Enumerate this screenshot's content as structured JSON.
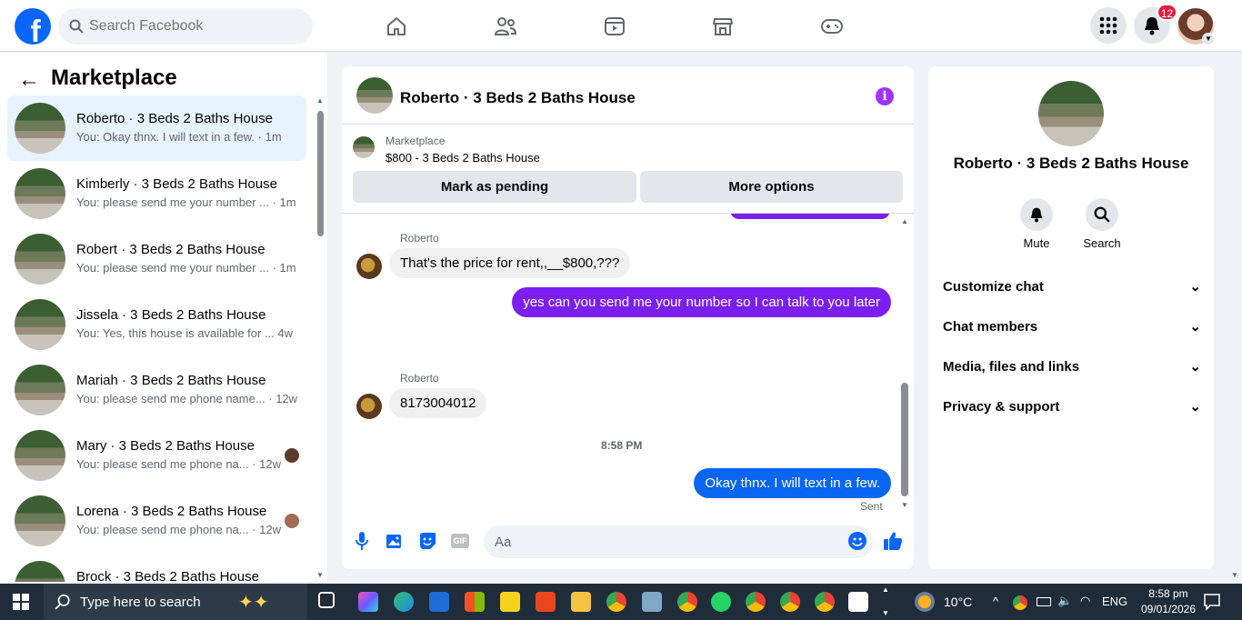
{
  "topbar": {
    "logo_letter": "f",
    "search_placeholder": "Search Facebook",
    "notification_count": "12",
    "nav_icons": [
      "home-icon",
      "friends-icon",
      "watch-icon",
      "marketplace-icon",
      "gaming-icon"
    ]
  },
  "sidebar": {
    "title": "Marketplace",
    "conversations": [
      {
        "name": "Roberto · 3 Beds 2 Baths House",
        "preview": "You: Okay thnx. I will text in a few. · 1m",
        "active": true
      },
      {
        "name": "Kimberly · 3 Beds 2 Baths House",
        "preview": "You: please send me your number ... · 1m"
      },
      {
        "name": "Robert · 3 Beds 2 Baths House",
        "preview": "You: please send me your number ... · 1m"
      },
      {
        "name": "Jissela · 3 Beds 2 Baths House",
        "preview": "You: Yes, this house is available for ...  4w"
      },
      {
        "name": "Mariah · 3 Beds 2 Baths House",
        "preview": "You: please send me phone name... · 12w"
      },
      {
        "name": "Mary · 3 Beds 2 Baths House",
        "preview": "You: please send me phone na... · 12w"
      },
      {
        "name": "Lorena · 3 Beds 2 Baths House",
        "preview": "You: please send me phone na... · 12w"
      },
      {
        "name": "Brock · 3 Beds 2 Baths House",
        "preview": ""
      }
    ]
  },
  "chat": {
    "title": "Roberto · 3 Beds 2 Baths House",
    "listing_source": "Marketplace",
    "listing_price": "$800 - 3 Beds 2 Baths House",
    "mark_pending": "Mark as pending",
    "more_options": "More options",
    "messages": {
      "sender1": "Roberto",
      "m1": "That's the price for rent,,__$800,???",
      "m2": "yes  can you send me your number so I can talk to you later",
      "sender2": "Roberto",
      "m3": "8173004012",
      "timestamp": "8:58 PM",
      "m4": "Okay thnx. I will text in a few.",
      "status": "Sent"
    },
    "composer_placeholder": "Aa"
  },
  "right_panel": {
    "name": "Roberto · 3 Beds 2 Baths House",
    "mute": "Mute",
    "search": "Search",
    "sections": [
      "Customize chat",
      "Chat members",
      "Media, files and links",
      "Privacy & support"
    ]
  },
  "taskbar": {
    "search_placeholder": "Type here to search",
    "temperature": "10°C",
    "language": "ENG",
    "time": "8:58 pm",
    "date": "09/01/2026"
  },
  "colors": {
    "brand": "#0866ff",
    "outgoing_purple": "#7b1ff0",
    "outgoing_blue": "#0a66f0",
    "info": "#a033ff",
    "badge": "#e41e3f"
  }
}
